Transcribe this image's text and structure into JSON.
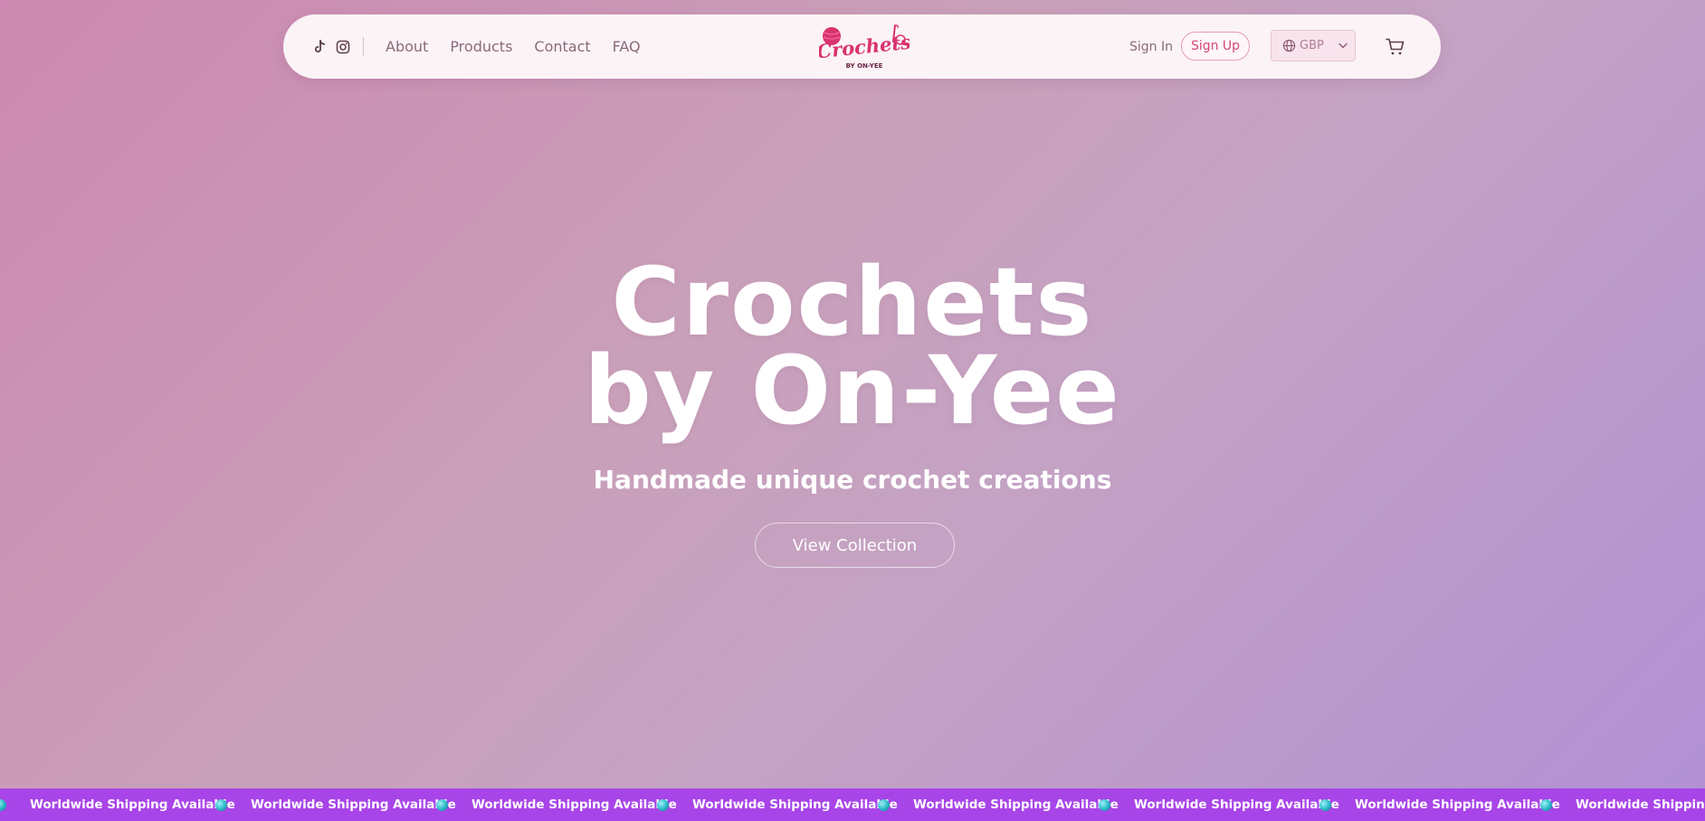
{
  "nav": {
    "social": [
      {
        "icon": "tiktok-icon"
      },
      {
        "icon": "instagram-icon"
      }
    ],
    "links": [
      "About",
      "Products",
      "Contact",
      "FAQ"
    ],
    "logo": {
      "line1": "Crochets",
      "line2": "BY ON-YEE"
    },
    "sign_in": "Sign In",
    "sign_up": "Sign Up",
    "currency": "GBP",
    "cart_icon": "cart-icon"
  },
  "hero": {
    "title_line1": "Crochets",
    "title_line2": "by On-Yee",
    "subtitle": "Handmade unique crochet creations",
    "cta": "View Collection"
  },
  "marquee": {
    "text": "Worldwide Shipping Available",
    "icon": "globe-icon"
  },
  "colors": {
    "accent": "#d4457a",
    "marquee_bg": "#a845e8",
    "nav_bg": "#fbf3f6"
  }
}
